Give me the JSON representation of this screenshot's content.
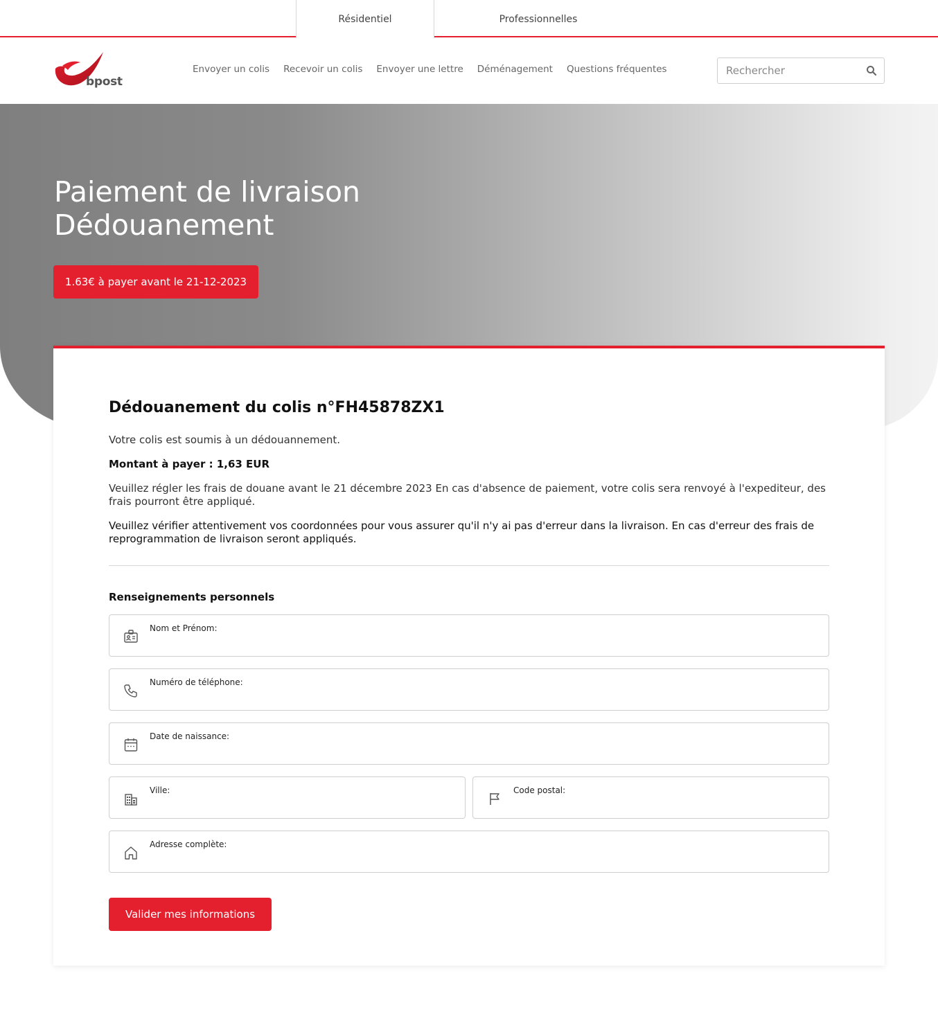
{
  "top_tabs": {
    "residential": "Résidentiel",
    "professional": "Professionnelles"
  },
  "header": {
    "logo_text": "bpost",
    "nav": [
      "Envoyer un colis",
      "Recevoir un colis",
      "Envoyer une lettre",
      "Déménagement",
      "Questions fréquentes"
    ],
    "search_placeholder": "Rechercher"
  },
  "hero": {
    "title_line1": "Paiement de livraison",
    "title_line2": "Dédouanement",
    "pay_button": "1.63€ à payer avant le 21-12-2023"
  },
  "card": {
    "heading": "Dédouanement du colis n°FH45878ZX1",
    "p1": "Votre colis est soumis à un dédouannement.",
    "p2": "Montant à payer : 1,63 EUR",
    "p3": "Veuillez régler les frais de douane avant le 21 décembre 2023 En cas d'absence de paiement, votre colis sera renvoyé à l'expediteur, des frais pourront être appliqué.",
    "p4": "Veuillez vérifier attentivement vos coordonnées pour vous assurer qu'il n'y ai pas d'erreur dans la livraison. En cas d'erreur des frais de reprogrammation de livraison seront appliqués.",
    "section_title": "Renseignements personnels",
    "fields": {
      "name": "Nom et Prénom:",
      "phone": "Numéro de téléphone:",
      "dob": "Date de naissance:",
      "city": "Ville:",
      "zip": "Code postal:",
      "address": "Adresse complète:"
    },
    "submit": "Valider mes informations"
  },
  "colors": {
    "brand_red": "#e4202f",
    "text_gray": "#666666"
  },
  "icons": [
    "search-icon",
    "id-card-icon",
    "phone-icon",
    "calendar-icon",
    "building-icon",
    "flag-icon",
    "home-icon"
  ]
}
